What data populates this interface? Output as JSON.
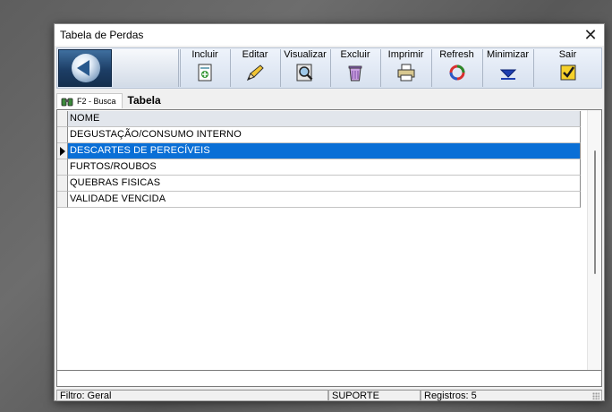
{
  "window": {
    "title": "Tabela de Perdas",
    "close_glyph": "✕"
  },
  "toolbar": {
    "buttons": [
      {
        "label": "Incluir",
        "icon": "add-document-icon"
      },
      {
        "label": "Editar",
        "icon": "pencil-icon"
      },
      {
        "label": "Visualizar",
        "icon": "magnifier-icon"
      },
      {
        "label": "Excluir",
        "icon": "trash-icon"
      },
      {
        "label": "Imprimir",
        "icon": "printer-icon"
      },
      {
        "label": "Refresh",
        "icon": "refresh-icon"
      },
      {
        "label": "Minimizar",
        "icon": "minimize-arrow-icon"
      },
      {
        "label": "Sair",
        "icon": "checkmark-icon"
      }
    ]
  },
  "search": {
    "label": "F2 - Busca",
    "section_title": "Tabela"
  },
  "grid": {
    "column_header": "NOME",
    "rows": [
      "DEGUSTAÇÃO/CONSUMO INTERNO",
      "DESCARTES DE PERECÍVEIS",
      "FURTOS/ROUBOS",
      "QUEBRAS FISICAS",
      "VALIDADE VENCIDA"
    ],
    "selected_index": 1
  },
  "statusbar": {
    "filter": "Filtro: Geral",
    "user": "SUPORTE",
    "records": "Registros: 5"
  },
  "colors": {
    "selection": "#0a6fd6",
    "header": "#e2e6ec"
  }
}
